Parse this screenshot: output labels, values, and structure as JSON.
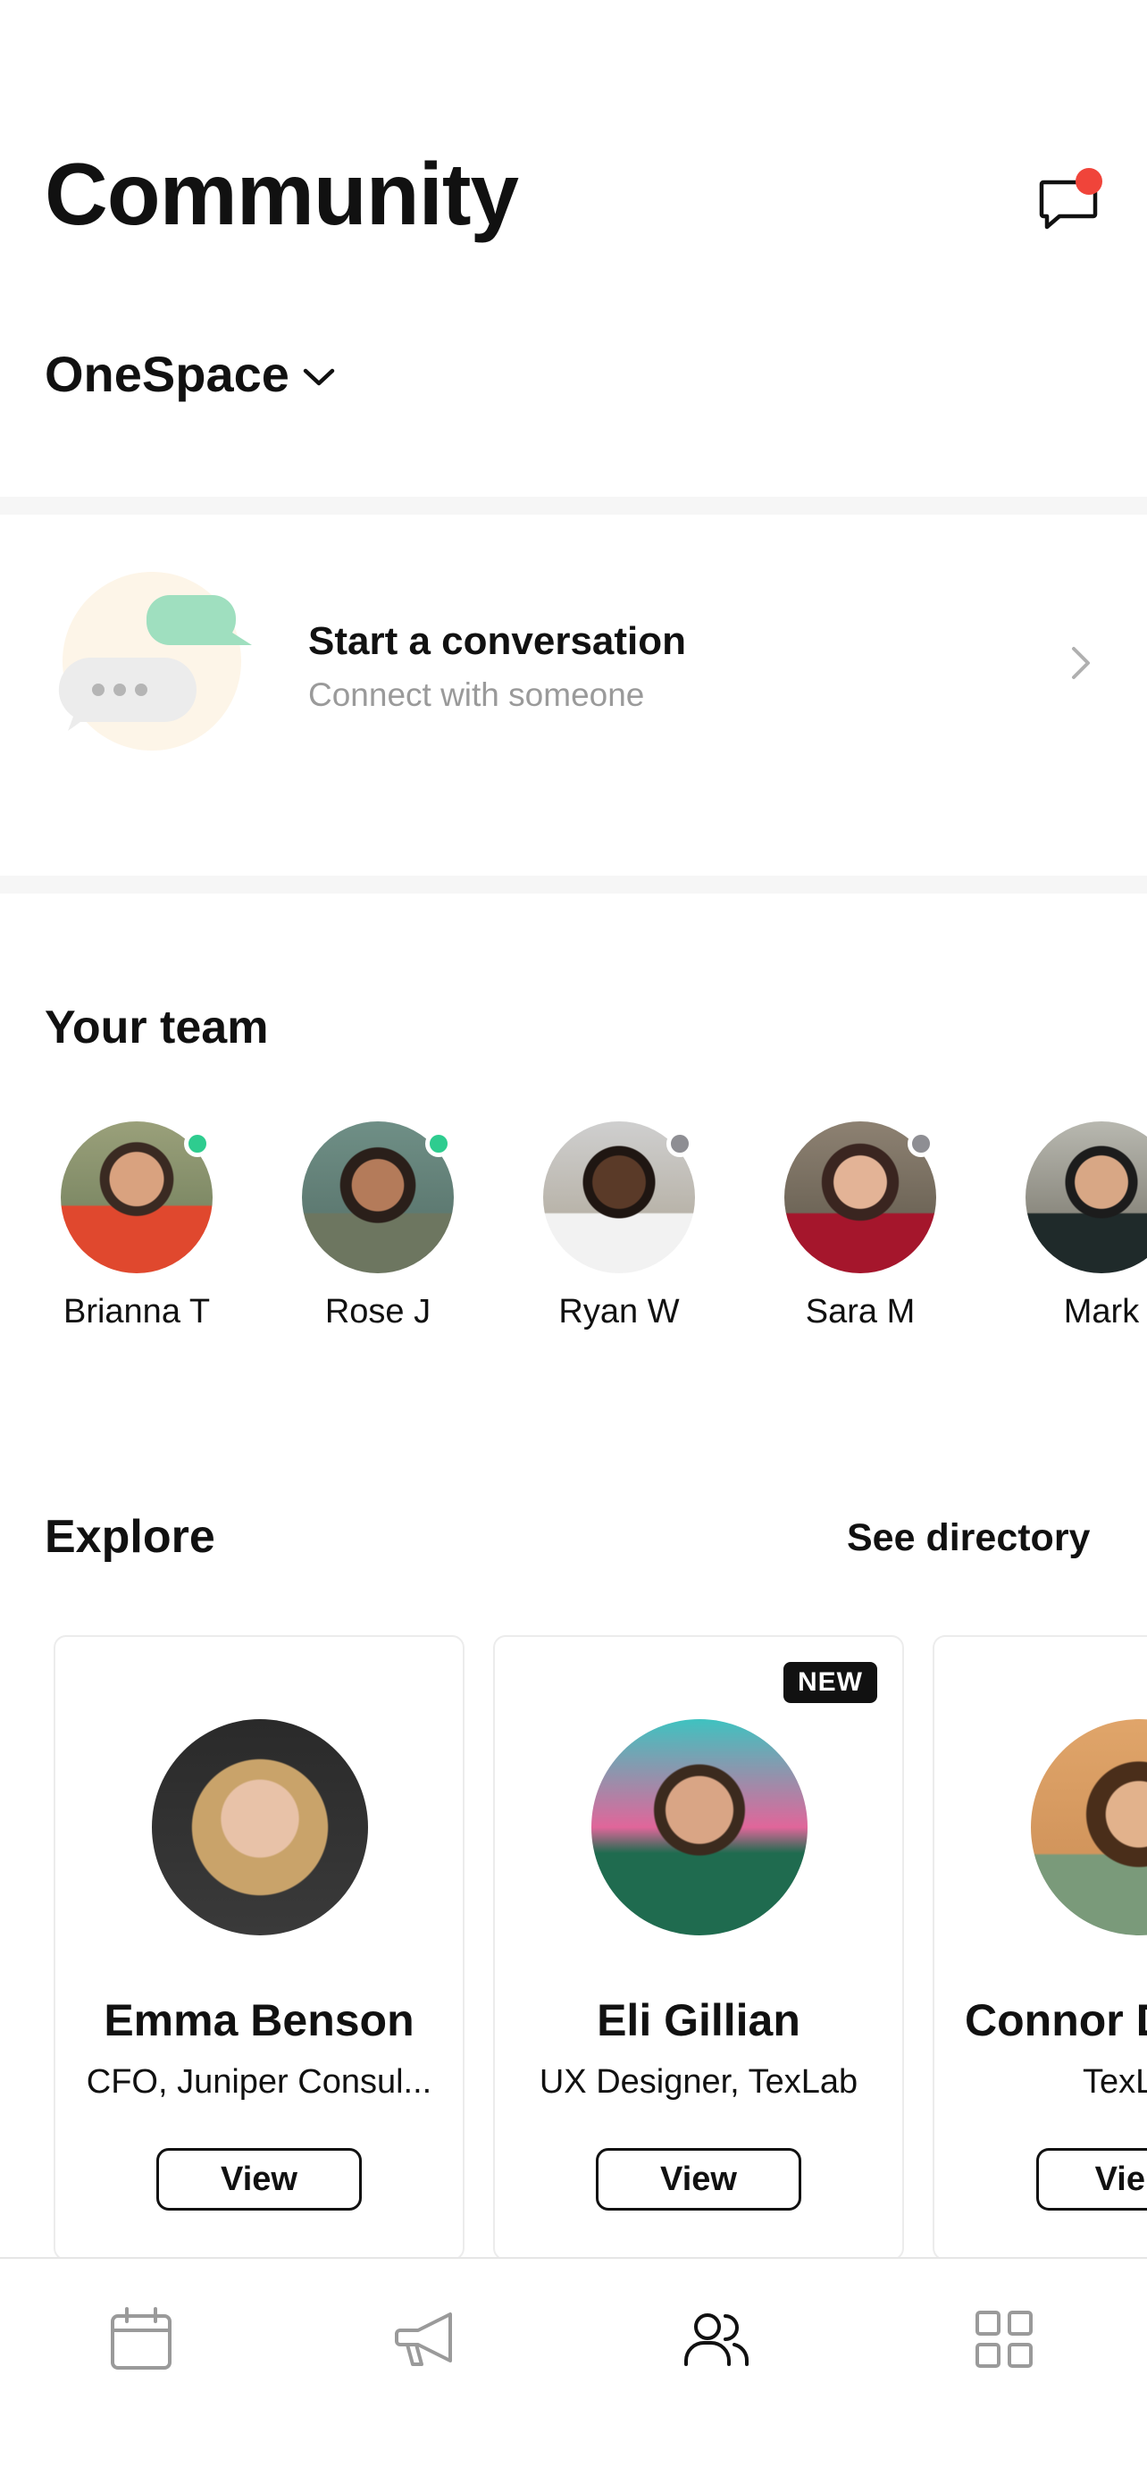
{
  "header": {
    "title": "Community",
    "workspace": "OneSpace"
  },
  "conversation": {
    "title": "Start a conversation",
    "subtitle": "Connect with someone"
  },
  "team": {
    "title": "Your team",
    "members": [
      {
        "name": "Brianna T",
        "status": "online"
      },
      {
        "name": "Rose J",
        "status": "online"
      },
      {
        "name": "Ryan W",
        "status": "away"
      },
      {
        "name": "Sara M",
        "status": "away"
      },
      {
        "name": "Mark"
      }
    ]
  },
  "explore": {
    "title": "Explore",
    "see_directory": "See directory",
    "cards": [
      {
        "name": "Emma Benson",
        "role": "CFO, Juniper Consul...",
        "view_label": "View"
      },
      {
        "name": "Eli Gillian",
        "role": "UX Designer, TexLab",
        "view_label": "View",
        "badge": "NEW"
      },
      {
        "name": "Connor D",
        "role": "TexL",
        "view_label": "Vie"
      }
    ]
  },
  "colors": {
    "online": "#2ecc8f",
    "away": "#8e8e93",
    "notification": "#f0443a",
    "active_nav": "#111111",
    "inactive_nav": "#9a9a9a"
  },
  "nav": [
    {
      "name": "calendar-icon",
      "active": false
    },
    {
      "name": "megaphone-icon",
      "active": false
    },
    {
      "name": "people-icon",
      "active": true
    },
    {
      "name": "grid-icon",
      "active": false
    }
  ]
}
